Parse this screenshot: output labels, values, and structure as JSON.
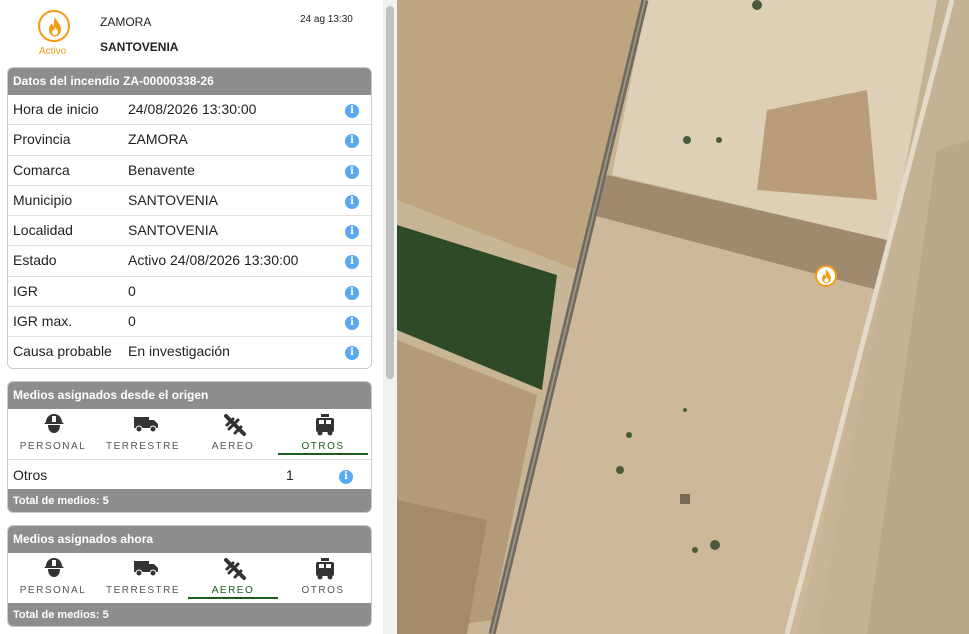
{
  "header": {
    "status": "Activo",
    "province": "ZAMORA",
    "municipality": "SANTOVENIA",
    "datetime": "24 ag 13:30",
    "status_color": "#f39c12"
  },
  "incident": {
    "title": "Datos del incendio ZA-00000338-26",
    "rows": [
      {
        "label": "Hora de inicio",
        "value": "24/08/2026 13:30:00"
      },
      {
        "label": "Provincia",
        "value": "ZAMORA"
      },
      {
        "label": "Comarca",
        "value": "Benavente"
      },
      {
        "label": "Municipio",
        "value": "SANTOVENIA"
      },
      {
        "label": "Localidad",
        "value": "SANTOVENIA"
      },
      {
        "label": "Estado",
        "value": "Activo 24/08/2026 13:30:00"
      },
      {
        "label": "IGR",
        "value": "0"
      },
      {
        "label": "IGR max.",
        "value": "0"
      },
      {
        "label": "Causa probable",
        "value": "En investigación"
      }
    ],
    "info_glyph": "i"
  },
  "origin": {
    "title": "Medios asignados desde el origen",
    "tabs": [
      "PERSONAL",
      "TERRESTRE",
      "AEREO",
      "OTROS"
    ],
    "active_tab": "OTROS",
    "resource_label": "Otros",
    "resource_count": "1",
    "total": "Total de medios: 5"
  },
  "now": {
    "title": "Medios asignados ahora",
    "tabs": [
      "PERSONAL",
      "TERRESTRE",
      "AEREO",
      "OTROS"
    ],
    "active_tab": "AEREO",
    "total": "Total de medios: 5"
  },
  "icons": {
    "status": "fire-icon",
    "info": "info-icon",
    "personal": "firefighter-helmet-icon",
    "terrestre": "truck-icon",
    "aereo": "airplane-icon",
    "otros": "fire-engine-icon",
    "map_marker": "fire-marker-icon"
  },
  "colors": {
    "accent": "#f39c12",
    "header_bar": "#8d8d8d",
    "info": "#5aa9f0",
    "active_tab": "#1b5e20"
  }
}
